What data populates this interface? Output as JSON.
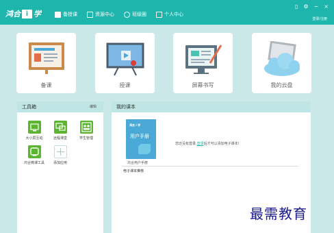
{
  "app": {
    "logo_text": "鸿合",
    "logo_box": "i",
    "logo_suffix": "学",
    "login_link": "登录/注册"
  },
  "nav": [
    {
      "label": "备授课",
      "icon": "lesson-icon",
      "active": true
    },
    {
      "label": "资源中心",
      "icon": "resource-icon",
      "active": false
    },
    {
      "label": "班级圈",
      "icon": "class-icon",
      "active": false
    },
    {
      "label": "个人中心",
      "icon": "person-icon",
      "active": false
    }
  ],
  "window_controls": {
    "phone": "▯",
    "settings": "⚙",
    "minimize": "−",
    "close": "×"
  },
  "tiles": [
    {
      "label": "备课",
      "icon": "lesson-board-icon"
    },
    {
      "label": "授课",
      "icon": "presentation-icon"
    },
    {
      "label": "屏幕书写",
      "icon": "screen-write-icon"
    },
    {
      "label": "我的云盘",
      "icon": "cloud-drive-icon"
    }
  ],
  "toolbox": {
    "title": "工具箱",
    "edit_label": "编辑",
    "tools": [
      {
        "label": "大小屏互动",
        "icon": "screen-interact-icon"
      },
      {
        "label": "远程课堂",
        "icon": "remote-class-icon"
      },
      {
        "label": "学生管理",
        "icon": "student-manage-icon"
      },
      {
        "label": "鸿合微课工具",
        "icon": "micro-lesson-icon"
      },
      {
        "label": "添加应用",
        "icon": "add-app-icon"
      }
    ]
  },
  "textbook": {
    "title": "我的课本",
    "book_brand": "鸿合",
    "book_title": "用户手册",
    "book_caption": "鸿合用户手册",
    "hint_before": "您还没有登录,",
    "hint_link": "登录",
    "hint_after": "后才可以添加电子课本!",
    "recommend_label": "电子课本推荐"
  },
  "watermark": "最需教育",
  "colors": {
    "brand": "#1db5ac",
    "tool_green": "#5cb531",
    "book_blue": "#4aa9d7"
  }
}
